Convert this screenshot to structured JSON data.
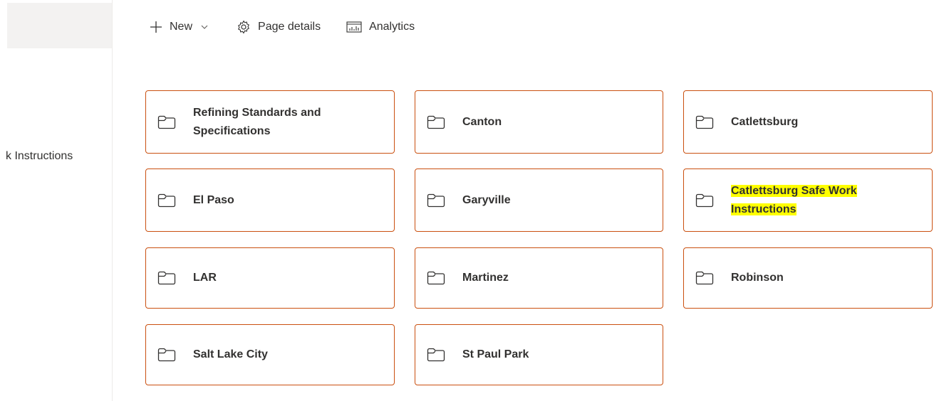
{
  "left_nav": {
    "item_label": "k Instructions"
  },
  "command_bar": {
    "new_label": "New",
    "page_details_label": "Page details",
    "analytics_label": "Analytics"
  },
  "folders": [
    {
      "label": "Refining Standards and Specifications",
      "icon": "folder-icon"
    },
    {
      "label": "Canton",
      "icon": "folder-icon"
    },
    {
      "label": "Catlettsburg",
      "icon": "folder-icon"
    },
    {
      "label": "El Paso",
      "icon": "folder-icon"
    },
    {
      "label": "Garyville",
      "icon": "folder-icon"
    },
    {
      "label": "Catlettsburg Safe Work Instructions",
      "icon": "folder-icon",
      "highlighted": true
    },
    {
      "label": "LAR",
      "icon": "folder-icon"
    },
    {
      "label": "Martinez",
      "icon": "folder-icon"
    },
    {
      "label": "Robinson",
      "icon": "folder-icon"
    },
    {
      "label": "Salt Lake City",
      "icon": "folder-icon"
    },
    {
      "label": "St Paul Park",
      "icon": "folder-icon"
    }
  ],
  "colors": {
    "tile_border": "#ca5010",
    "highlight": "#ffff00",
    "text": "#323130"
  }
}
